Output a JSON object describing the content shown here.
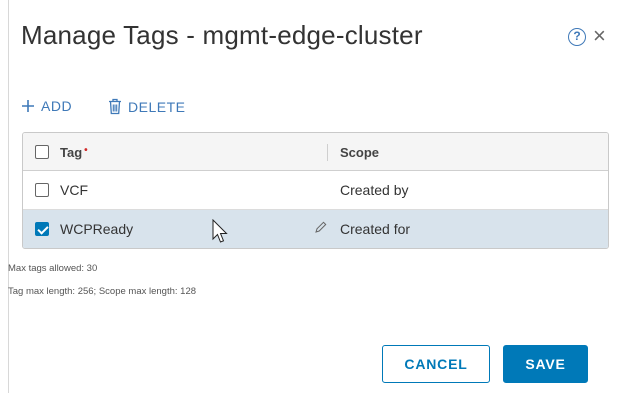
{
  "dialog": {
    "title": "Manage Tags - mgmt-edge-cluster",
    "help_icon": "help-circle-icon",
    "close_label": "×"
  },
  "toolbar": {
    "add_label": "ADD",
    "delete_label": "DELETE"
  },
  "grid": {
    "columns": [
      {
        "label": "Tag",
        "required_mark": "•"
      },
      {
        "label": "Scope"
      }
    ],
    "rows": [
      {
        "tag": "VCF",
        "scope": "Created by",
        "selected": false
      },
      {
        "tag": "WCPReady",
        "scope": "Created for",
        "selected": true
      }
    ]
  },
  "info": {
    "max_tags": "Max tags allowed: 30",
    "max_length": "Tag max length: 256; Scope max length: 128"
  },
  "footer": {
    "cancel_label": "CANCEL",
    "save_label": "SAVE"
  },
  "colors": {
    "accent": "#0079b8",
    "selected_row": "#d8e3ec",
    "required": "#d12a2a"
  }
}
